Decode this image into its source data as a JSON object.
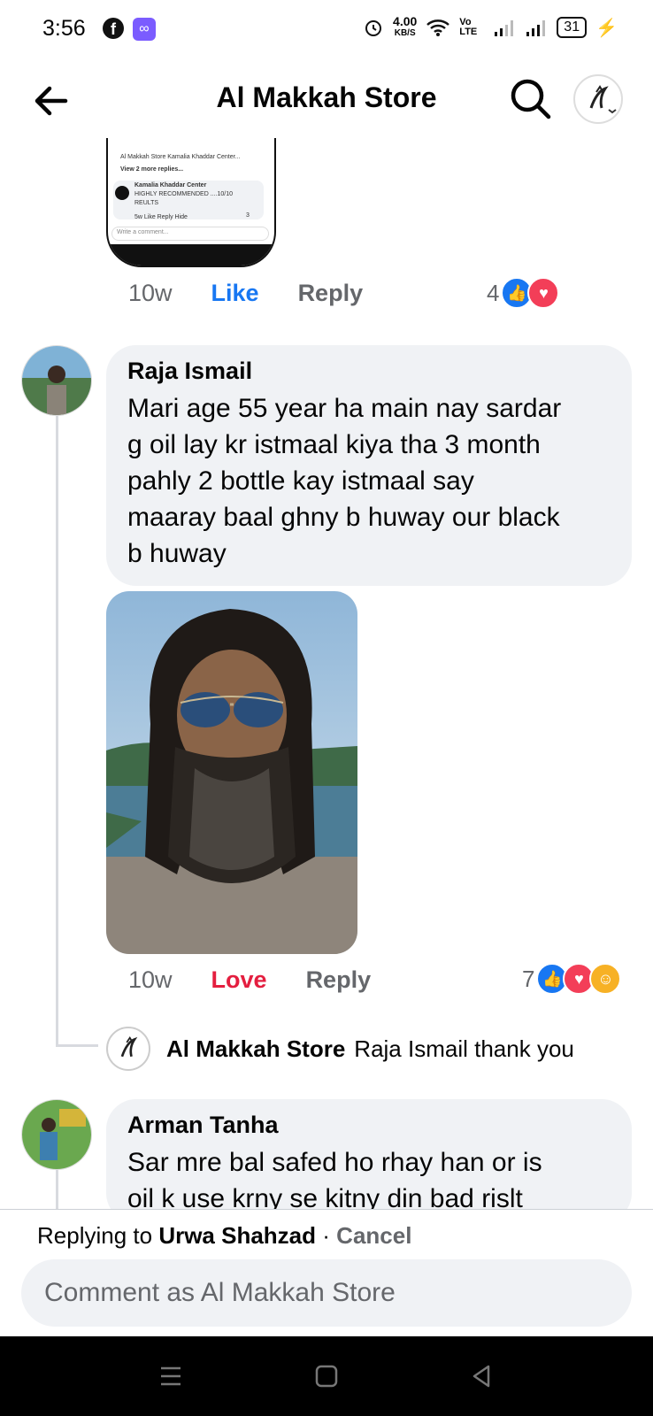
{
  "status_bar": {
    "time": "3:56",
    "speed_value": "4.00",
    "speed_unit": "KB/S",
    "network": "Vo LTE",
    "battery": "31"
  },
  "header": {
    "title": "Al Makkah Store"
  },
  "shared_post_preview": {
    "lines": [
      "Al Makkah Store Kamalia Khaddar Center...",
      "View 2 more replies...",
      "Kamalia Khaddar Center",
      "HIGHLY RECOMMENDED ....10/10",
      "REULTS",
      "5w   Like   Reply   Hide",
      "Write a comment..."
    ],
    "reaction_count": "3"
  },
  "comments": [
    {
      "time": "10w",
      "action": "Like",
      "reply": "Reply",
      "reaction_count": "4"
    },
    {
      "author": "Raja Ismail",
      "text_lines": [
        "Mari age 55 year ha main nay sardar",
        "g oil lay kr istmaal kiya tha 3 month",
        "pahly 2 bottle kay istmaal say",
        "maaray baal ghny b huway our black",
        "b huway"
      ],
      "time": "10w",
      "action": "Love",
      "reply": "Reply",
      "reaction_count": "7"
    },
    {
      "author": "Arman Tanha",
      "text_lines": [
        "Sar mre bal safed ho rhay han or is",
        "oil k use krny se kitny din bad rislt"
      ]
    }
  ],
  "page_reply": {
    "author": "Al Makkah Store",
    "text": "Raja Ismail thank you"
  },
  "footer": {
    "replying_prefix": "Replying to",
    "replying_to": "Urwa Shahzad",
    "separator": "·",
    "cancel": "Cancel",
    "placeholder": "Comment as Al Makkah Store"
  },
  "colors": {
    "like_blue": "#1877f2",
    "love_red": "#e41e3f",
    "bubble_bg": "#f0f2f5",
    "secondary_text": "#65676b"
  }
}
